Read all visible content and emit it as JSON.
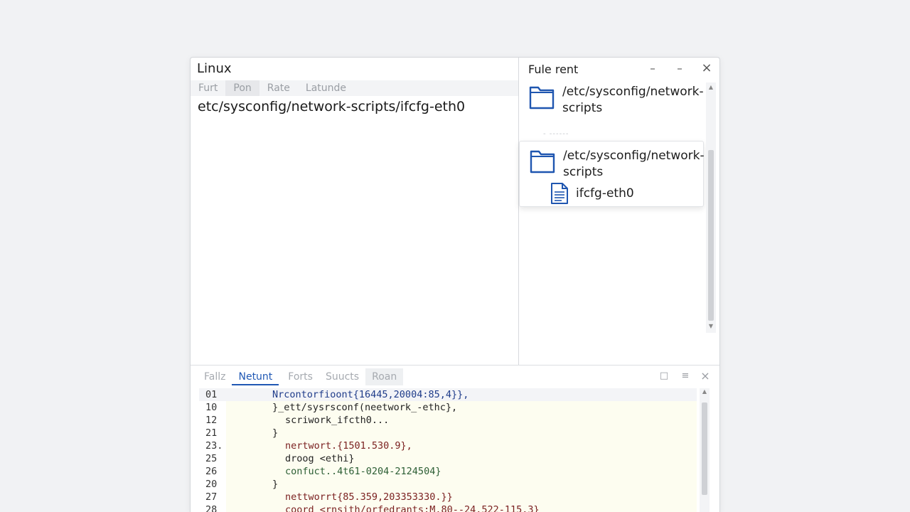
{
  "editor": {
    "app_title": "Linux",
    "menu": [
      "Furt",
      "Pon",
      "Rate",
      "Latunde"
    ],
    "path": "etc/sysconfig/network-scripts/ifcfg-eth0"
  },
  "file_panel": {
    "title": "Fule rent",
    "items": [
      {
        "label": "/etc/sysconfig/network-scripts",
        "icon": "folder-icon"
      }
    ],
    "dropdown": {
      "folder": "/etc/sysconfig/network-scripts",
      "file": "ifcfg-eth0",
      "folder_icon": "folder-icon",
      "file_icon": "document-icon"
    },
    "separator": "- ------"
  },
  "bottom_panel": {
    "tabs": [
      "Fallz",
      "Netunt",
      "Forts",
      "Suucts",
      "Roan"
    ],
    "active_tab": "Netunt",
    "lines": [
      {
        "num": "01",
        "text": "Nrcontorfioont{16445,20004:85,4}},"
      },
      {
        "num": "10",
        "text": "}_ett/sysrsconf(neetwork_-ethc},"
      },
      {
        "num": "12",
        "text": "scriwork_ifcth0..."
      },
      {
        "num": "21",
        "text": "}"
      },
      {
        "num": "23.",
        "text": "nertwort.{1501.530.9},"
      },
      {
        "num": "25",
        "text": "droog <ethi}"
      },
      {
        "num": "26",
        "text": "confuct..4t61-0204-2124504}"
      },
      {
        "num": "20",
        "text": "}"
      },
      {
        "num": "27",
        "text": "nettworrt{85.359,203353330.}}"
      },
      {
        "num": "28",
        "text": "coord <rnsith/orfedrants:M.80--24.522-115.3}"
      }
    ]
  },
  "colors": {
    "accent": "#2058b4",
    "folder_blue": "#1f56b0",
    "code_bg": "#fdfdf0"
  }
}
